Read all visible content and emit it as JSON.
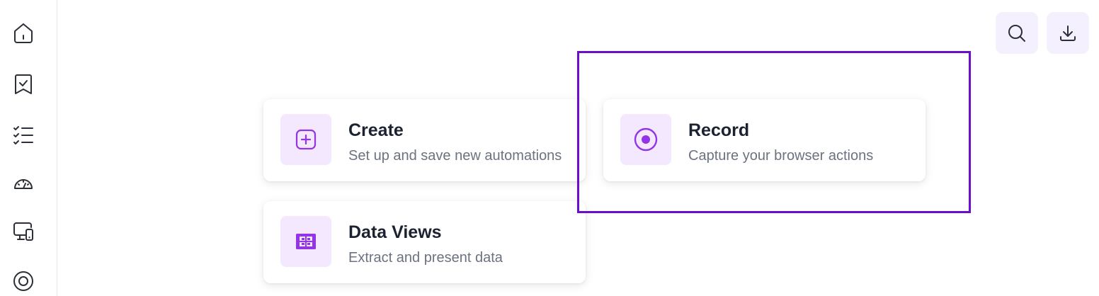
{
  "sidebar": {
    "items": [
      {
        "icon": "home-icon"
      },
      {
        "icon": "bookmark-check-icon"
      },
      {
        "icon": "checklist-icon"
      },
      {
        "icon": "gauge-icon"
      },
      {
        "icon": "devices-icon"
      },
      {
        "icon": "target-icon"
      }
    ]
  },
  "toolbar": {
    "search_icon": "search-icon",
    "download_icon": "download-icon"
  },
  "cards": {
    "create": {
      "title": "Create",
      "description": "Set up and save new automations",
      "icon": "plus-square-icon"
    },
    "record": {
      "title": "Record",
      "description": "Capture your browser actions",
      "icon": "record-icon"
    },
    "data_views": {
      "title": "Data Views",
      "description": "Extract and present data",
      "icon": "grid-icon"
    }
  },
  "colors": {
    "accent": "#9334e6",
    "icon_bg": "#f3e8fd",
    "highlight": "#6a0dcc",
    "title": "#1c2230",
    "muted": "#6b7280"
  }
}
